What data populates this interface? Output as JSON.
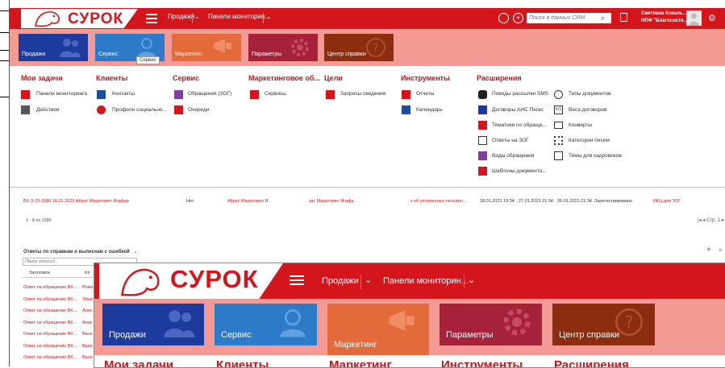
{
  "app": {
    "logo_text": "СУРОК"
  },
  "nav": {
    "sales": "Продажи",
    "dashboards": "Панели мониторин...",
    "search_placeholder": "Поиск в данных CRM",
    "user_name": "Светлана Коваль...",
    "user_org": "НПФ \"Благососто..."
  },
  "tiles": [
    {
      "label": "Продажи",
      "color": "#1d3b9c"
    },
    {
      "label": "Сервис",
      "color": "#2d7ac9"
    },
    {
      "label": "Маркетинг",
      "color": "#e36b3b"
    },
    {
      "label": "Параметры",
      "color": "#a6223a"
    },
    {
      "label": "Центр справки",
      "color": "#8c2d10"
    }
  ],
  "tooltip": "Сервис",
  "sitemap": {
    "tasks": {
      "title": "Мои задачи",
      "items": [
        "Панели мониторинга",
        "Действия"
      ]
    },
    "clients": {
      "title": "Клиенты",
      "items": [
        "Контакты",
        "Профили социально..."
      ]
    },
    "service": {
      "title": "Сервис",
      "items": [
        "Обращения (ЗОГ)",
        "Очереди"
      ]
    },
    "marketing": {
      "title": "Маркетинговое об...",
      "items": [
        "Сервисы"
      ]
    },
    "goals": {
      "title": "Цели",
      "items": [
        "Запросы сведения"
      ]
    },
    "tools": {
      "title": "Инструменты",
      "items": [
        "Отчеты",
        "Календарь"
      ]
    },
    "extensions": {
      "title": "Расширения",
      "col1": [
        "Поводы рассылки SMS",
        "Договоры АИС Пегас",
        "Тематики по обраще...",
        "Ответы на ЗОГ",
        "Виды обращения",
        "Шаблоны документо..."
      ],
      "col2": [
        "Типы документов",
        "Веса договоров",
        "Конверты",
        "Категории писем",
        "Темы для кадровиков"
      ]
    }
  },
  "grid": {
    "row": {
      "c1": "ВХ-З-23-1586 18.01.2023 Айрат Маратович Ягафар",
      "c2": "Нет",
      "c3": "Айрат Маратович Я",
      "c4": "зат Маратович Ягафа",
      "c5": "з об уплаченных пенсион...",
      "c6": "18.01.2023 19:34",
      "c7": "27.01.2023 21:34",
      "c8": "26.01.2023 21:34",
      "c9": "Зарегистрировано",
      "c10": "ИКЦ для ЗОГ"
    },
    "count": "1 - 8 из 1586",
    "pager": "Стр. 1",
    "view_title": "Ответы по справкам и выпискам с ошибкой",
    "search_placeholder": "Поиск записей",
    "col_header": "Заголовок",
    "col_header2": "Кл",
    "rows": [
      "Ответ на обращение ВХ...",
      "Ответ на обращение ВХ...",
      "Ответ на обращение ВХ...",
      "Ответ на обращение ВХ...",
      "Ответ на обращение ВХ...",
      "Ответ на обращение ВХ...",
      "Ответ на обращение ВХ..."
    ],
    "row_tails": [
      "Рома",
      "Эльв",
      "Алек",
      "Алек",
      "Васи",
      "Васи",
      "Васи"
    ]
  },
  "overlay": {
    "logo_text": "СУРОК",
    "sales": "Продажи",
    "dashboards": "Панели мониторин...",
    "tiles": [
      "Продажи",
      "Сервис",
      "Маркетинг",
      "Параметры",
      "Центр справки"
    ],
    "headings": [
      "Мои задачи",
      "Клиенты",
      "Маркетинг",
      "Инструменты",
      "Расширения"
    ]
  },
  "colors": {
    "brand_red": "#d4161c",
    "tile_bar": "#f39a95",
    "link_red": "#c8161b"
  }
}
